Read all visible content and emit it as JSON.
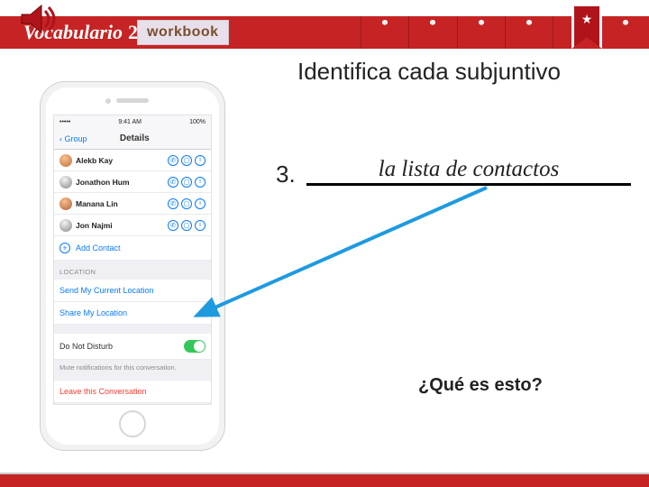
{
  "banner": {
    "vocab_label": "Vocabulario",
    "vocab_number": "2",
    "workbook_label": "workbook"
  },
  "instruction": "Identifica cada subjuntivo",
  "question": {
    "number": "3.",
    "answer": "la lista de contactos",
    "subtext": "¿Qué es esto?"
  },
  "phone": {
    "status": {
      "time": "9:41 AM",
      "battery": "100%",
      "carrier": "•••••"
    },
    "nav": {
      "back": "‹ Group",
      "title": "Details"
    },
    "contacts": [
      {
        "name": "Alekb Kay"
      },
      {
        "name": "Jonathon Hum"
      },
      {
        "name": "Manana Lin"
      },
      {
        "name": "Jon Najmi"
      }
    ],
    "add_contact": "Add Contact",
    "section_location": "LOCATION",
    "send_location": "Send My Current Location",
    "share_location": "Share My Location",
    "dnd": "Do Not Disturb",
    "mute_note": "Mute notifications for this conversation.",
    "leave": "Leave this Conversation"
  }
}
